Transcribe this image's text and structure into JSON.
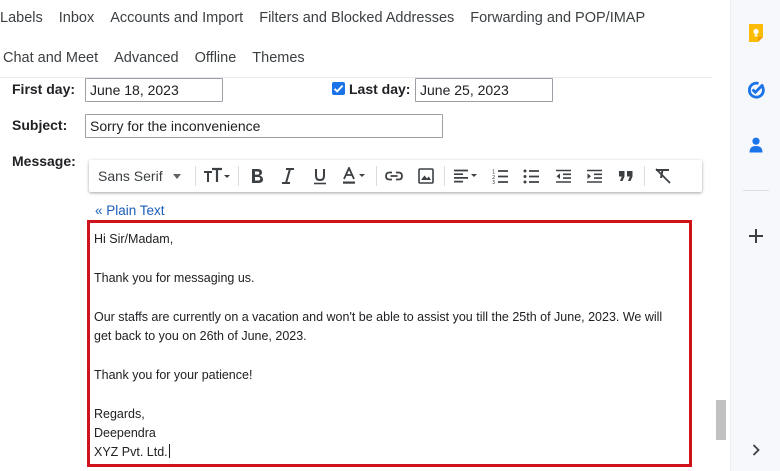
{
  "settings_tabs": {
    "row1": [
      "Labels",
      "Inbox",
      "Accounts and Import",
      "Filters and Blocked Addresses",
      "Forwarding and POP/IMAP"
    ],
    "row2": [
      "Chat and Meet",
      "Advanced",
      "Offline",
      "Themes"
    ]
  },
  "vacation": {
    "first_day_label": "First day:",
    "first_day_value": "June 18, 2023",
    "last_day_label": "Last day:",
    "last_day_value": "June 25, 2023",
    "last_day_checked": true,
    "subject_label": "Subject:",
    "subject_value": "Sorry for the inconvenience",
    "message_label": "Message:"
  },
  "toolbar": {
    "font_name": "Sans Serif",
    "icons": [
      "font-size-icon",
      "bold-icon",
      "italic-icon",
      "underline-icon",
      "text-color-icon",
      "link-icon",
      "image-icon",
      "align-icon",
      "numbered-list-icon",
      "bulleted-list-icon",
      "indent-less-icon",
      "indent-more-icon",
      "quote-icon",
      "remove-formatting-icon"
    ]
  },
  "plain_text_link": "« Plain Text",
  "message_lines": [
    "Hi Sir/Madam,",
    "",
    "Thank you for messaging us.",
    "",
    "Our staffs are currently on a vacation and won't be able to assist you till the 25th of June, 2023. We will",
    "get back to you on 26th of June, 2023.",
    "",
    "Thank you for your patience!",
    "",
    "Regards,",
    "Deependra",
    "XYZ Pvt. Ltd."
  ],
  "side_rail": {
    "icons": [
      "keep-icon",
      "tasks-icon",
      "contacts-icon",
      "add-icon",
      "chevron-right-icon"
    ],
    "colors": {
      "keep": "#fbbc04",
      "tasks": "#1a73e8",
      "contacts": "#1a73e8"
    }
  },
  "colors": {
    "accent": "#1a73e8",
    "highlight_border": "#d0121b",
    "link": "#1a5eb8"
  }
}
